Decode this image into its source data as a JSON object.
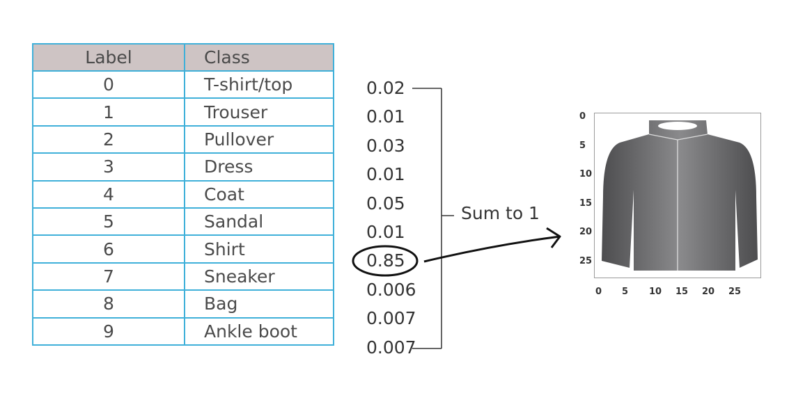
{
  "table": {
    "headers": {
      "label": "Label",
      "class": "Class"
    },
    "rows": [
      {
        "label": "0",
        "class": "T-shirt/top"
      },
      {
        "label": "1",
        "class": "Trouser"
      },
      {
        "label": "2",
        "class": "Pullover"
      },
      {
        "label": "3",
        "class": "Dress"
      },
      {
        "label": "4",
        "class": "Coat"
      },
      {
        "label": "5",
        "class": "Sandal"
      },
      {
        "label": "6",
        "class": "Shirt"
      },
      {
        "label": "7",
        "class": "Sneaker"
      },
      {
        "label": "8",
        "class": "Bag"
      },
      {
        "label": "9",
        "class": "Ankle boot"
      }
    ]
  },
  "probabilities": [
    "0.02",
    "0.01",
    "0.03",
    "0.01",
    "0.05",
    "0.01",
    "0.85",
    "0.006",
    "0.007",
    "0.007"
  ],
  "highlighted_index": 6,
  "bracket_label": "Sum to 1",
  "image_axes": {
    "y_ticks": [
      "0",
      "5",
      "10",
      "15",
      "20",
      "25"
    ],
    "x_ticks": [
      "0",
      "5",
      "10",
      "15",
      "20",
      "25"
    ]
  },
  "colors": {
    "table_border": "#3fb0d9",
    "header_background": "#cec4c4",
    "shirt_fill": "#6a6a6c"
  }
}
